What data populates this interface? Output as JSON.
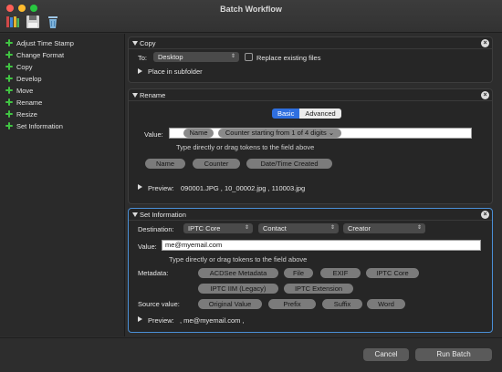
{
  "window": {
    "title": "Batch Workflow"
  },
  "toolbar": {
    "icons": [
      "books-icon",
      "save-icon",
      "trash-icon"
    ]
  },
  "sidebar": {
    "items": [
      {
        "label": "Adjust Time Stamp"
      },
      {
        "label": "Change Format"
      },
      {
        "label": "Copy"
      },
      {
        "label": "Develop"
      },
      {
        "label": "Move"
      },
      {
        "label": "Rename"
      },
      {
        "label": "Resize"
      },
      {
        "label": "Set Information"
      }
    ]
  },
  "copy": {
    "title": "Copy",
    "to_label": "To:",
    "to_value": "Desktop",
    "replace_label": "Replace existing files",
    "subfolder_label": "Place in subfolder"
  },
  "rename": {
    "title": "Rename",
    "mode_tabs": [
      "Basic",
      "Advanced"
    ],
    "active_tab": "Basic",
    "value_label": "Value:",
    "value_tokens": [
      "Name",
      "Counter starting from 1 of 4 digits"
    ],
    "hint": "Type directly or drag tokens to the field above",
    "tokens": [
      "Name",
      "Counter",
      "Date/Time Created"
    ],
    "preview_label": "Preview:",
    "preview_value": "090001.JPG , 10_00002.jpg , 110003.jpg"
  },
  "set_information": {
    "title": "Set Information",
    "destination_label": "Destination:",
    "destination_selects": [
      "IPTC Core",
      "Contact",
      "Creator"
    ],
    "value_label": "Value:",
    "value": "me@myemail.com",
    "hint": "Type directly or drag tokens to the field above",
    "metadata_label": "Metadata:",
    "metadata_tokens": [
      "ACDSee Metadata",
      "File",
      "EXIF",
      "IPTC Core",
      "IPTC IIM (Legacy)",
      "IPTC Extension"
    ],
    "source_label": "Source value:",
    "source_tokens": [
      "Original Value",
      "Prefix",
      "Suffix",
      "Word"
    ],
    "preview_label": "Preview:",
    "preview_value": ", me@myemail.com ,"
  },
  "buttons": {
    "cancel": "Cancel",
    "run": "Run Batch"
  },
  "colors": {
    "accent": "#2f6fe0",
    "plus": "#41c443",
    "active_border": "#4a8fd6"
  }
}
